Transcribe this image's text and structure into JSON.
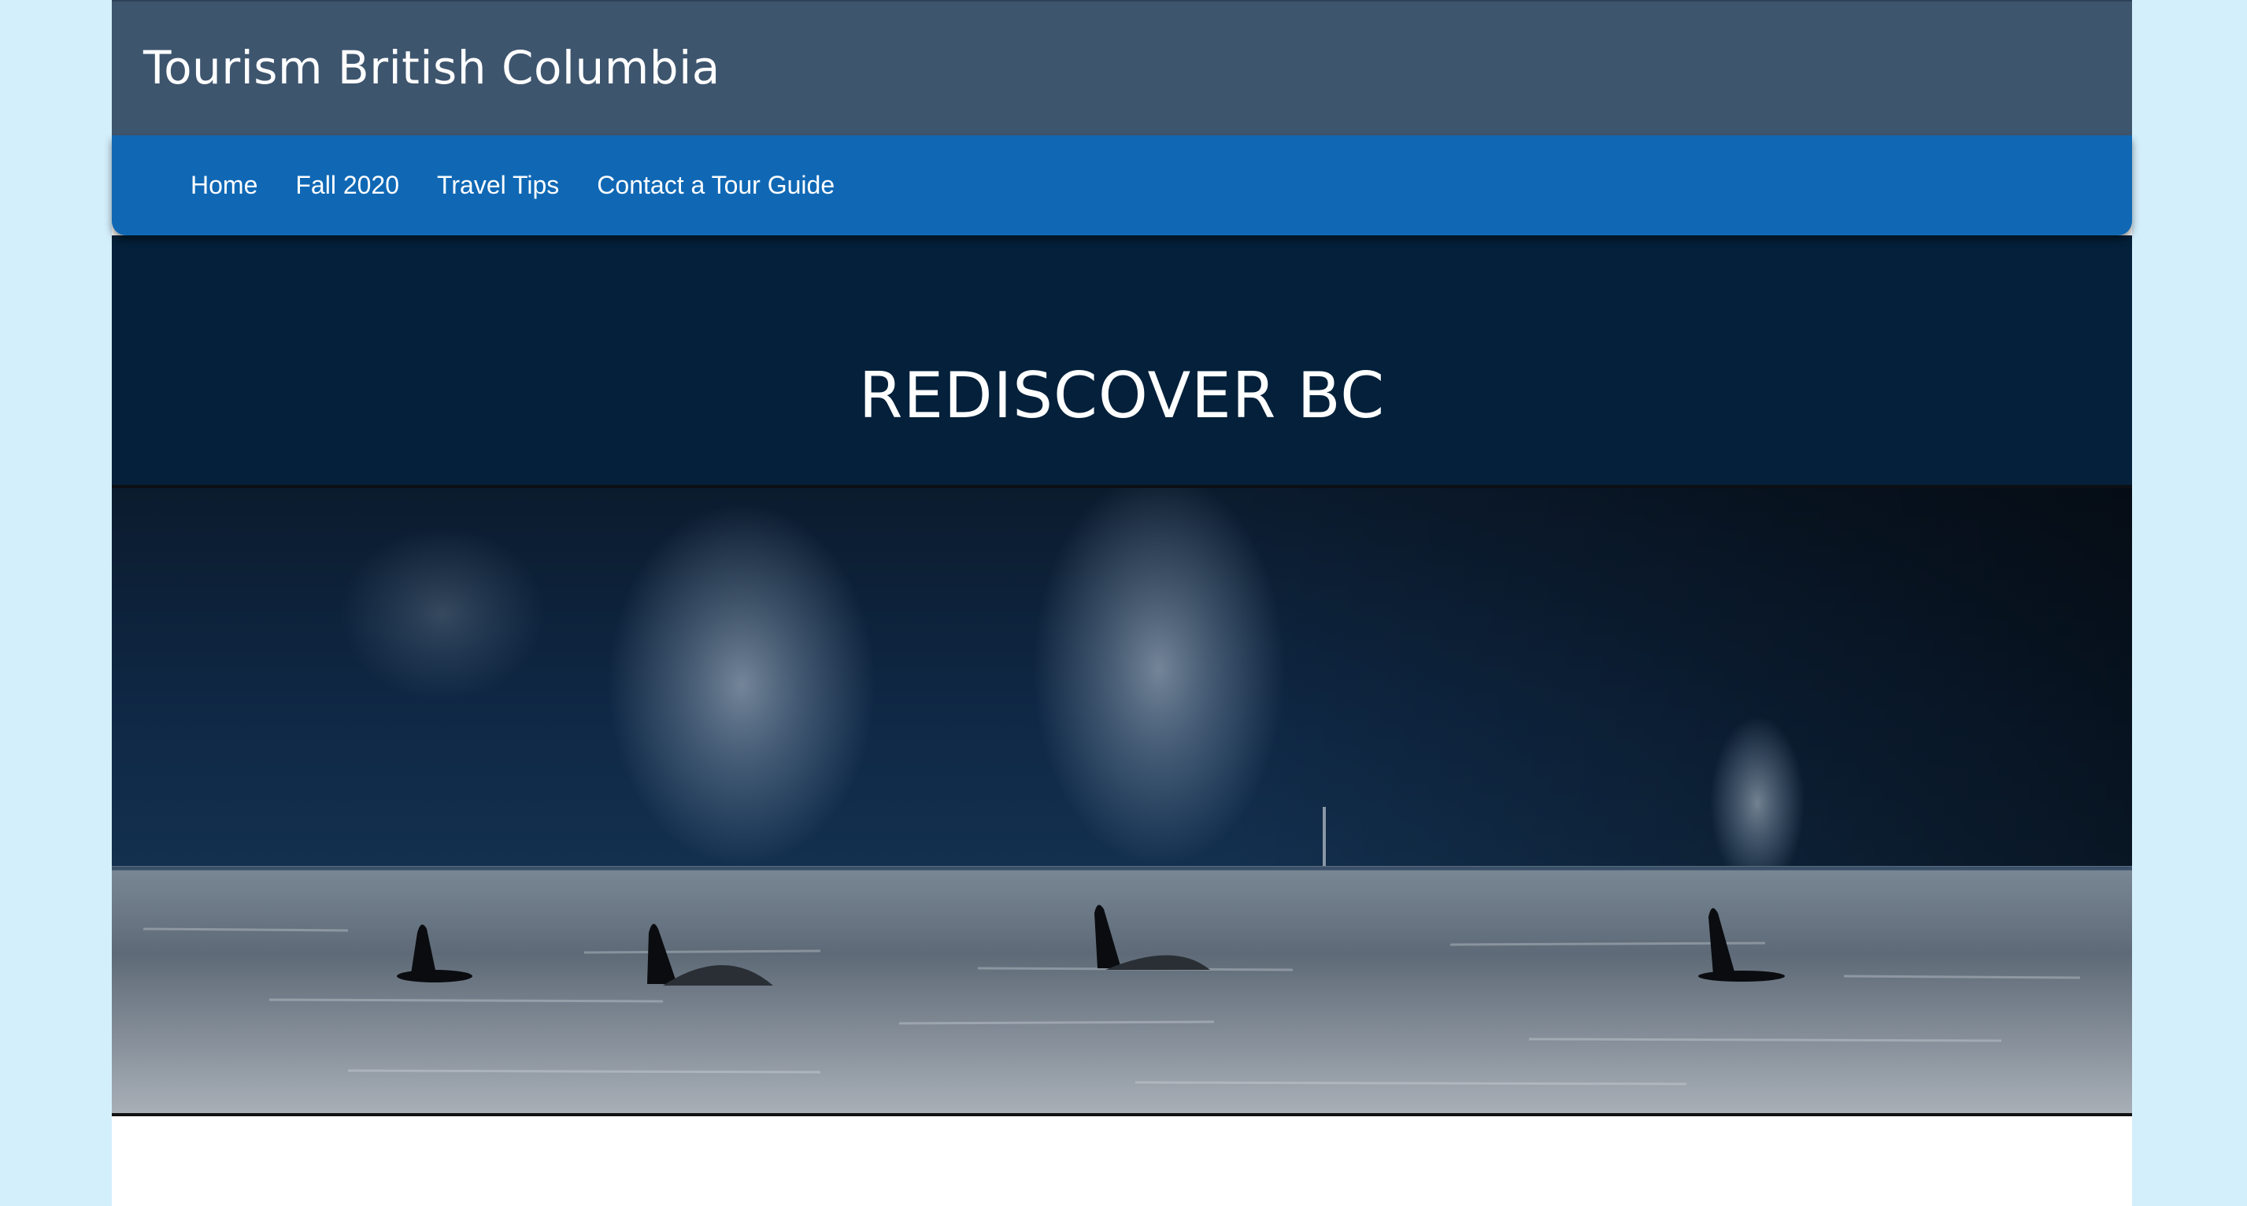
{
  "header": {
    "site_title": "Tourism British Columbia"
  },
  "nav": {
    "items": [
      {
        "label": "Home"
      },
      {
        "label": "Fall 2020"
      },
      {
        "label": "Travel Tips"
      },
      {
        "label": "Contact a Tour Guide"
      }
    ]
  },
  "hero": {
    "title": "REDISCOVER BC"
  },
  "colors": {
    "page_background": "#d4effc",
    "header_background": "#3e556e",
    "nav_background": "#1068b5",
    "hero_band_background": "#04203a"
  }
}
